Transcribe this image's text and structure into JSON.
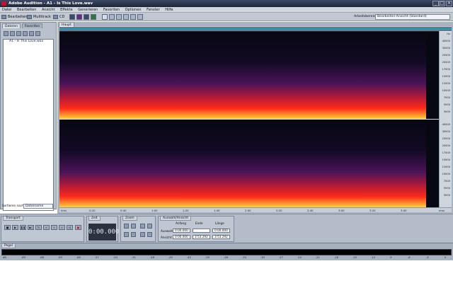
{
  "window": {
    "title": "Adobe Audition - A1 - Is This Love.wav",
    "minimize": "_",
    "maximize": "□",
    "close": "✕"
  },
  "menu": [
    "Datei",
    "Bearbeiten",
    "Ansicht",
    "Effekte",
    "Generieren",
    "Favoriten",
    "Optionen",
    "Fenster",
    "Hilfe"
  ],
  "toolbar": {
    "edit_label": "Bearbeiten",
    "multitrack_label": "Multitrack",
    "cd_label": "CD",
    "workspace_label": "Arbeitsbereich:",
    "workspace_value": "Bearbeiten-Ansicht (Standard)"
  },
  "files_panel": {
    "tab_files": "Dateien",
    "tab_favorites": "Favoriten",
    "items": [
      "A1 - Is This Love.wav"
    ],
    "sort_label": "Sortieren nach:",
    "sort_value": "Dateiname"
  },
  "editor": {
    "tab_label": "Haupt"
  },
  "freq_ticks": {
    "top": [
      "Hz",
      "40000",
      "30000",
      "25000",
      "20000",
      "17000",
      "15000",
      "12000",
      "10000",
      "7000",
      "5000",
      "3000"
    ],
    "bottom": [
      "40000",
      "30000",
      "25000",
      "20000",
      "17000",
      "15000",
      "12000",
      "10000",
      "7000",
      "5000",
      "3000"
    ]
  },
  "time_ticks": [
    "hms",
    "0:20",
    "0:40",
    "1:00",
    "1:20",
    "1:40",
    "2:00",
    "2:20",
    "2:40",
    "3:00",
    "3:20",
    "3:40",
    "hms"
  ],
  "transport": {
    "title": "Transport"
  },
  "time_panel": {
    "title": "Zeit",
    "value": "0:00.000"
  },
  "zoom_panel": {
    "title": "Zoom"
  },
  "selection_panel": {
    "title": "Auswahl/Ansicht",
    "col_start": "Anfang",
    "col_end": "Ende",
    "col_length": "Länge",
    "row_selection": "Auswahl",
    "row_view": "Ansicht",
    "sel_start": "0:00.000",
    "sel_end": "",
    "sel_length": "0:00.000",
    "view_start": "0:00.000",
    "view_end": "3:53.292",
    "view_length": "3:53.292"
  },
  "level_panel": {
    "title": "Pegel",
    "ticks": [
      "dB",
      "-69",
      "-66",
      "-63",
      "-60",
      "-57",
      "-54",
      "-51",
      "-48",
      "-45",
      "-42",
      "-39",
      "-36",
      "-33",
      "-30",
      "-27",
      "-24",
      "-21",
      "-18",
      "-15",
      "-12",
      "-9",
      "-6",
      "-3",
      "0"
    ]
  },
  "colors": {
    "spectro_hot": "#ffd23a",
    "spectro_mid": "#ff2a1a",
    "spectro_low": "#8a1a7a",
    "spectro_bg": "#080812",
    "progress": "#34c1e0"
  }
}
